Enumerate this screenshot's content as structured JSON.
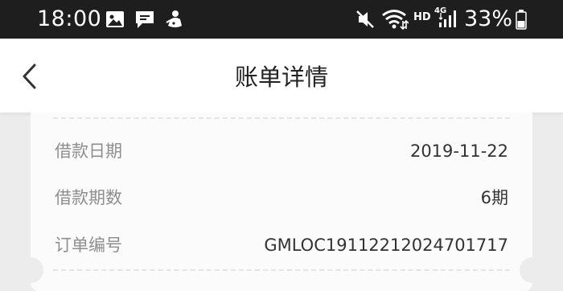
{
  "status_bar": {
    "time": "18:00",
    "network_hd": "HD",
    "network_type": "4G",
    "battery_percent": "33%",
    "icons": [
      "image-icon",
      "message-icon",
      "app-notification-icon",
      "mute-icon",
      "wifi-icon",
      "signal-icon",
      "battery-icon"
    ]
  },
  "header": {
    "title": "账单详情",
    "back_icon": "chevron-left-icon"
  },
  "loan_details": {
    "rows": [
      {
        "label": "借款日期",
        "value": "2019-11-22"
      },
      {
        "label": "借款期数",
        "value": "6期"
      },
      {
        "label": "订单编号",
        "value": "GMLOC19112212024701717"
      }
    ]
  },
  "colors": {
    "status_bar_bg": "#1e1e1e",
    "page_bg": "#ececec",
    "card_bg": "#fbfbfb",
    "label_text": "#8e8e8e",
    "value_text": "#333333"
  }
}
